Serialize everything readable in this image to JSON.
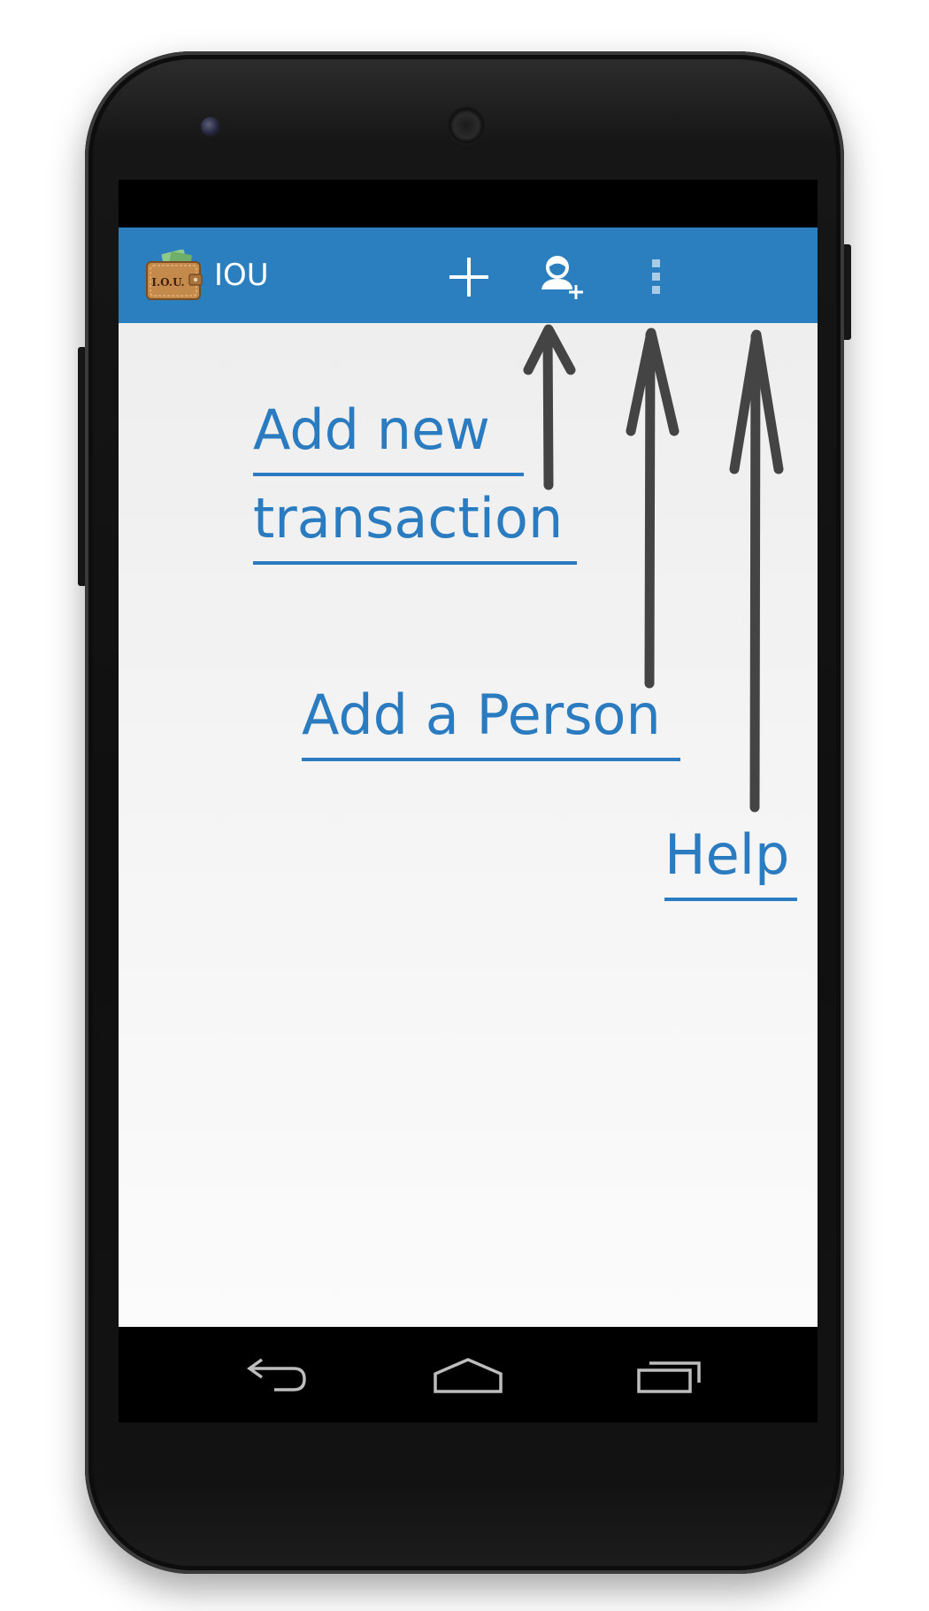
{
  "app": {
    "title": "IOU",
    "icon": "wallet-iou-icon",
    "icon_text": "I.O.U."
  },
  "action_bar": {
    "color": "#2b7fbf",
    "actions": [
      {
        "id": "add-transaction",
        "icon": "plus-icon"
      },
      {
        "id": "add-person",
        "icon": "add-person-icon"
      },
      {
        "id": "overflow-menu",
        "icon": "more-vert-icon"
      }
    ]
  },
  "annotations": {
    "add_transaction_line1": "Add new",
    "add_transaction_line2": "transaction",
    "add_person": "Add a Person",
    "help": "Help",
    "color": "#2a7bbf",
    "arrow_color": "#444444"
  },
  "nav": {
    "back": "back-icon",
    "home": "home-icon",
    "recents": "recents-icon"
  }
}
